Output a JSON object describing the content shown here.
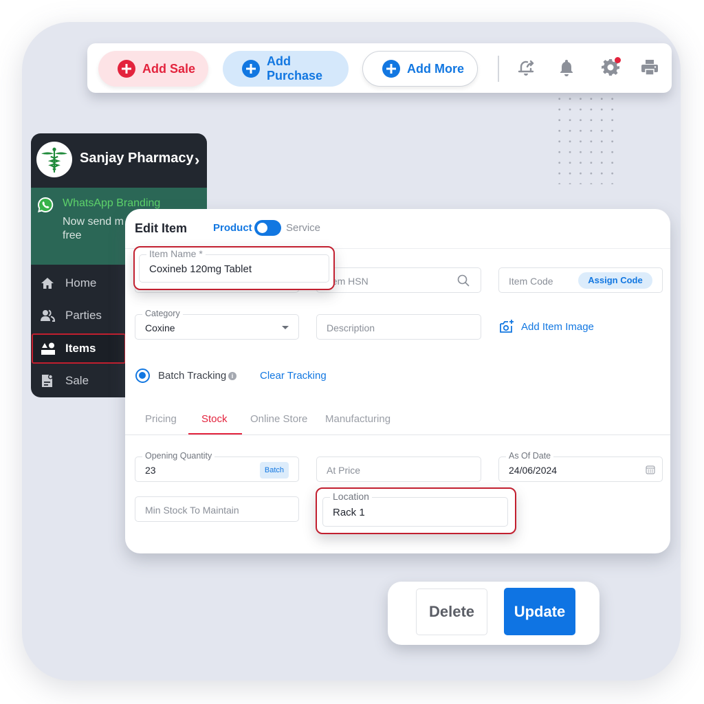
{
  "toolbar": {
    "add_sale": "Add Sale",
    "add_purchase": "Add Purchase",
    "add_more": "Add More",
    "icons": [
      "reminder-bell-icon",
      "notification-bell-icon",
      "settings-gear-icon",
      "printer-icon"
    ],
    "colors": {
      "sale": "#e3233d",
      "purchase": "#1277e1",
      "notification_dot": "#e3233d"
    }
  },
  "sidebar": {
    "business_name": "Sanjay Pharmacy",
    "whatsapp": {
      "title": "WhatsApp Branding",
      "body": "Now send m your own Wh free"
    },
    "items": [
      {
        "label": "Home",
        "icon": "home-icon",
        "active": false
      },
      {
        "label": "Parties",
        "icon": "users-icon",
        "active": false
      },
      {
        "label": "Items",
        "icon": "items-shapes-icon",
        "active": true
      },
      {
        "label": "Sale",
        "icon": "sale-document-icon",
        "active": false
      }
    ]
  },
  "edit_item": {
    "title": "Edit Item",
    "type_toggle": {
      "left": "Product",
      "right": "Service",
      "selected": "Product"
    },
    "item_name": {
      "label": "Item Name *",
      "value": "Coxineb 120mg Tablet"
    },
    "item_hsn": {
      "placeholder": "Item HSN"
    },
    "item_code": {
      "placeholder": "Item Code",
      "button": "Assign Code"
    },
    "category": {
      "label": "Category",
      "value": "Coxine"
    },
    "description": {
      "placeholder": "Description"
    },
    "add_image": "Add Item Image",
    "batch_tracking": {
      "label": "Batch Tracking",
      "checked": true
    },
    "clear_tracking": "Clear Tracking",
    "tabs": [
      {
        "label": "Pricing",
        "active": false
      },
      {
        "label": "Stock",
        "active": true
      },
      {
        "label": "Online Store",
        "active": false
      },
      {
        "label": "Manufacturing",
        "active": false
      }
    ],
    "stock": {
      "opening_quantity": {
        "label": "Opening Quantity",
        "value": "23",
        "chip": "Batch"
      },
      "at_price": {
        "placeholder": "At Price"
      },
      "as_of_date": {
        "label": "As Of Date",
        "value": "24/06/2024"
      },
      "min_stock": {
        "placeholder": "Min Stock To Maintain"
      },
      "location": {
        "label": "Location",
        "value": "Rack 1"
      }
    }
  },
  "actions": {
    "delete": "Delete",
    "update": "Update"
  }
}
